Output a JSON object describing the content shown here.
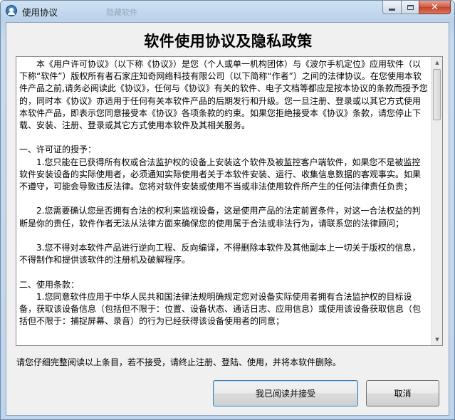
{
  "window": {
    "title": "使用协议",
    "background_title_hint": "隐藏软件"
  },
  "heading": "软件使用协议及隐私政策",
  "agreement": {
    "paragraphs": [
      "　　本《用户许可协议》（以下称《协议》）是您（个人或单一机构团体）与《波尔手机定位》应用软件（以下称“软件”）版权所有者石家庄知奇网络科技有限公司（以下简称“作者”）之间的法律协议。在您使用本软件产品之前,请务必阅读此《协议》，任何与《协议》有关的软件、电子文档等都应是按本协议的条款而授予您的，同时本《协议》亦适用于任何有关本软件产品的后期发行和升级。您一旦注册、登录或以其它方式使用本软件产品，即表示您同意接受本《协议》各项条款的约束。如果您拒绝接受本《协议》条款，请您停止下载、安装、注册、登录或其它方式使用本软件及其相关服务。",
      "",
      "一、许可证的授予：",
      "　　1.您只能在已获得所有权或合法监护权的设备上安装这个软件及被监控客户端软件，如果您不是被监控软件安装设备的实际使用者，必须通知实际使用者关于本软件安装、运行、收集信息数据的客观事实。如果不遵守，可能会导致违反法律。您将对软件安装或使用不当或非法使用软件所产生的任何法律责任负责；",
      "",
      "　　2.您需要确认您是否拥有合法的权利来监视设备，这是使用产品的法定前置条件，对这一合法权益的判断是你的责任，软件作者无法从法律方面来确保您的使用属于合法或非法行为，请联系您的法律顾问；",
      "",
      "　　3.您不得对本软件产品进行逆向工程、反向编译，不得删除本软件及其他副本上一切关于版权的信息，不得制作和提供该软件的注册机及破解程序。",
      "",
      "二、使用条款：",
      "　　1.您同意软件应用于中华人民共和国法律法规明确规定您对设备实际使用者拥有合法监护权的目标设备，获取该设备信息（包括但不限于：位置、设备状态、通话日志、应用信息）或使用该设备获取信息（包括但不限于：捕捉屏幕、录音）的行为已经获得该设备使用者的同意；"
    ]
  },
  "notice": "请您仔细完整阅读以上条目，若不接受，请终止注册、登陆、使用，并将本软件删除。",
  "buttons": {
    "accept": "我已阅读并接受",
    "cancel": "取消"
  },
  "icons": {
    "app": "user-avatar-icon",
    "minimize": "minimize-icon",
    "maximize": "maximize-icon",
    "close": "close-icon",
    "scroll_up": "arrow-up-icon",
    "scroll_down": "arrow-down-icon"
  },
  "colors": {
    "close_button": "#c2432a",
    "default_button_border": "#3c7fb1"
  }
}
